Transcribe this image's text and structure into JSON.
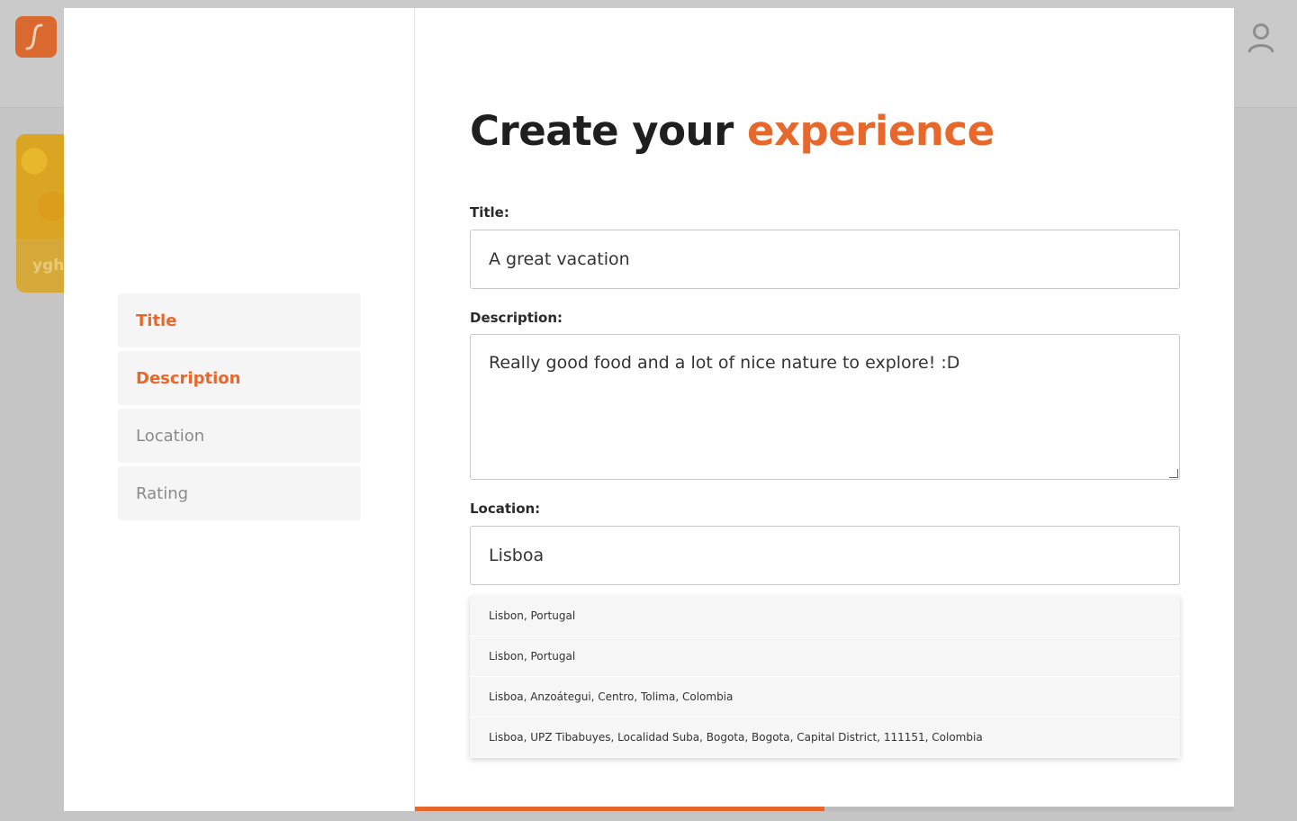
{
  "background": {
    "card_label": "ygh"
  },
  "sidebar": {
    "steps": [
      {
        "label": "Title",
        "active": true
      },
      {
        "label": "Description",
        "active": true
      },
      {
        "label": "Location",
        "active": false
      },
      {
        "label": "Rating",
        "active": false
      }
    ]
  },
  "form": {
    "headline_plain": "Create your",
    "headline_accent": "experience",
    "title_label": "Title:",
    "title_value": "A great vacation",
    "description_label": "Description:",
    "description_value": "Really good food and a lot of nice nature to explore! :D",
    "location_label": "Location:",
    "location_value": "Lisboa",
    "suggestions": [
      "Lisbon, Portugal",
      "Lisbon, Portugal",
      "Lisboa, Anzoátegui, Centro, Tolima, Colombia",
      "Lisboa, UPZ Tibabuyes, Localidad Suba, Bogota, Bogota, Capital District, 111151, Colombia"
    ]
  },
  "progress": {
    "fraction": 0.5
  },
  "colors": {
    "accent": "#e8672a",
    "overlay": "#c8c8c8"
  },
  "icons": {
    "logo": "brand-logo-icon",
    "user": "user-icon"
  }
}
